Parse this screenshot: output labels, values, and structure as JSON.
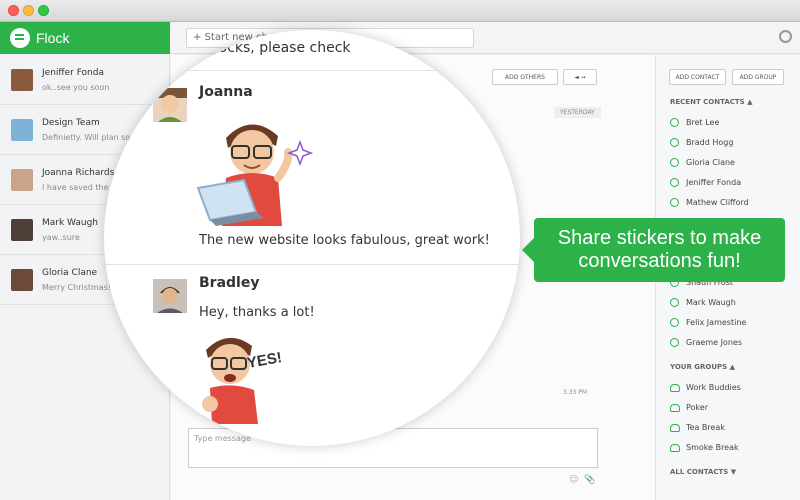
{
  "app": {
    "brand": "Flock"
  },
  "toolbar": {
    "search_placeholder": "+ Start new chat"
  },
  "conversations": [
    {
      "name": "Jeniffer Fonda",
      "snippet": "ok..see you soon"
    },
    {
      "name": "Design Team",
      "snippet": "Definietly. Will plan some"
    },
    {
      "name": "Joanna Richards",
      "snippet": "I have saved the green"
    },
    {
      "name": "Mark Waugh",
      "snippet": "yaw..sure"
    },
    {
      "name": "Gloria Clane",
      "snippet": "Merry Christmas!"
    }
  ],
  "chat": {
    "add_others": "ADD OTHERS",
    "date_label": "YESTERDAY",
    "time": "3.33 PM",
    "compose_placeholder": "Type message"
  },
  "magnified": {
    "top_line": "mocks, please check",
    "messages": [
      {
        "author": "Joanna",
        "text": "The new website looks fabulous, great work!"
      },
      {
        "author": "Bradley",
        "text": "Hey, thanks a lot!"
      }
    ],
    "sticker_text": "YES!"
  },
  "tooltip": {
    "line1": "Share stickers to make",
    "line2": "conversations fun!"
  },
  "right_panel": {
    "add_contact": "ADD CONTACT",
    "add_group": "ADD GROUP",
    "recent_title": "RECENT CONTACTS",
    "recent": [
      "Bret Lee",
      "Bradd Hogg",
      "Gloria Clane",
      "Jeniffer Fonda",
      "Mathew Clifford",
      "Shaun Frost",
      "Mark Waugh",
      "Felix Jamestine",
      "Graeme Jones"
    ],
    "groups_title": "YOUR GROUPS",
    "groups": [
      "Work Buddies",
      "Poker",
      "Tea Break",
      "Smoke Break"
    ],
    "all_contacts": "ALL CONTACTS"
  },
  "colors": {
    "brand_green": "#2db24a"
  }
}
